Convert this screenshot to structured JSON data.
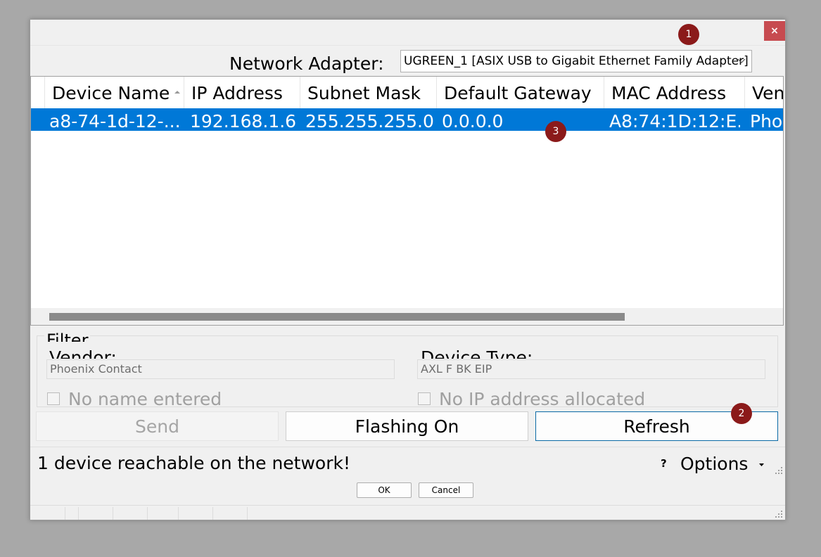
{
  "dialog": {
    "close_label": "×"
  },
  "badges": {
    "b1": "1",
    "b2": "2",
    "b3": "3"
  },
  "adapter": {
    "label": "Network Adapter:",
    "selected": "UGREEN_1 [ASIX USB to Gigabit Ethernet Family Adapter]"
  },
  "grid": {
    "columns": [
      "Device Name",
      "IP Address",
      "Subnet Mask",
      "Default Gateway",
      "MAC Address",
      "Ven"
    ],
    "rows": [
      [
        "a8-74-1d-12-...",
        "192.168.1.6",
        "255.255.255.0",
        "0.0.0.0",
        "A8:74:1D:12:E...",
        "Pho"
      ]
    ]
  },
  "filter": {
    "legend": "Filter",
    "vendor_label": "Vendor:",
    "vendor_value": "Phoenix Contact",
    "device_type_label": "Device Type:",
    "device_type_value": "AXL F BK EIP",
    "no_name_label": "No name entered",
    "no_ip_label": "No IP address allocated"
  },
  "buttons": {
    "send": "Send",
    "flashing": "Flashing On",
    "refresh": "Refresh",
    "ok": "OK",
    "cancel": "Cancel"
  },
  "status": {
    "message": "1 device reachable on the network!",
    "help": "?",
    "options": "Options"
  },
  "colors": {
    "selection": "#0078d7",
    "badge": "#8b1a1a",
    "close": "#c74b50"
  }
}
